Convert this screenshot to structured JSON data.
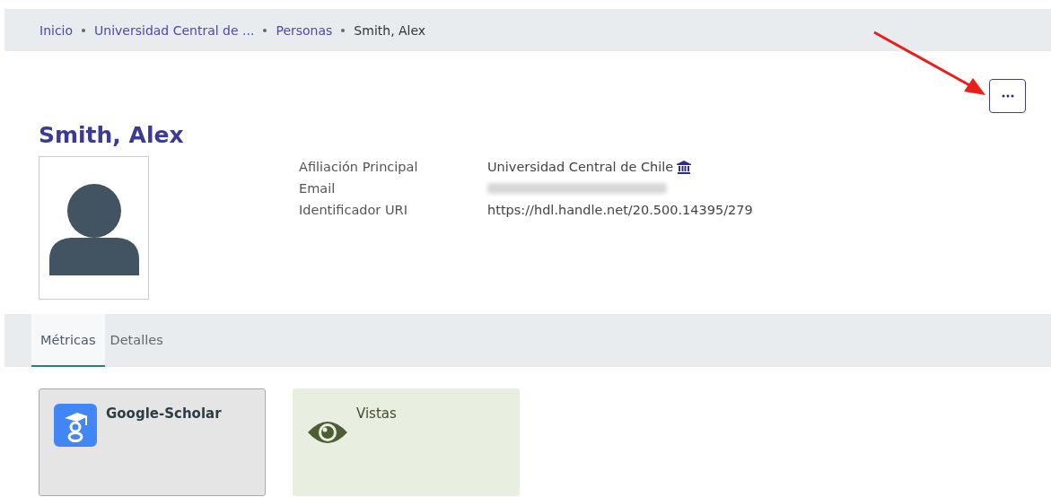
{
  "breadcrumb": [
    {
      "label": "Inicio",
      "kind": "link"
    },
    {
      "label": "Universidad Central de ...",
      "kind": "link"
    },
    {
      "label": "Personas",
      "kind": "link"
    },
    {
      "label": "Smith, Alex",
      "kind": "current"
    }
  ],
  "title": "Smith, Alex",
  "fields": [
    {
      "label": "Afiliación Principal",
      "value": "Universidad Central de Chile",
      "kind": "institution"
    },
    {
      "label": "Email",
      "kind": "blurred"
    },
    {
      "label": "Identificador URI",
      "value": "https://hdl.handle.net/20.500.14395/279",
      "kind": "text"
    }
  ],
  "tabs": [
    {
      "label": "Métricas",
      "selected": true
    },
    {
      "label": "Detalles",
      "selected": false
    }
  ],
  "cards": [
    {
      "title": "Google-Scholar",
      "kind": "scholar",
      "color": "#e5e5e5"
    },
    {
      "title": "Vistas",
      "kind": "views",
      "color": "#e8efe0"
    }
  ]
}
